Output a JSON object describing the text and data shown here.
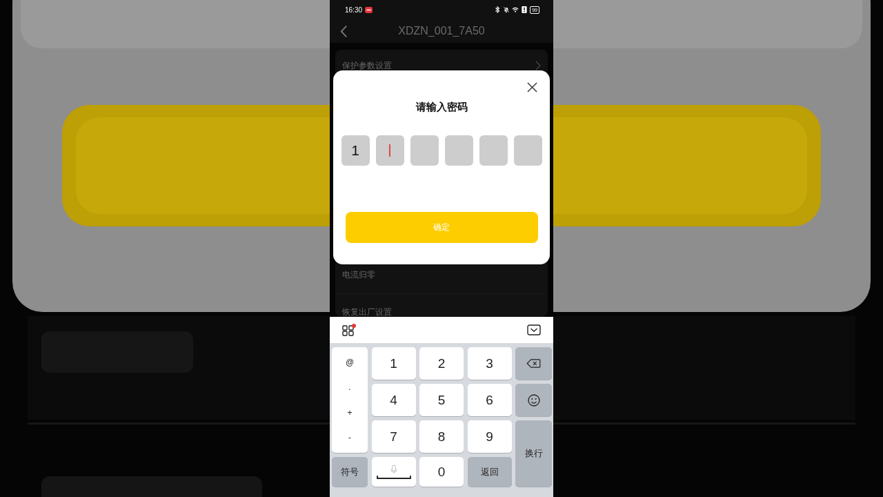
{
  "status_bar": {
    "time": "16:30",
    "battery": "99"
  },
  "header": {
    "title": "XDZN_001_7A50"
  },
  "settings_items": [
    {
      "label": "保护参数设置",
      "chevron": true
    },
    {
      "label": "电流归零",
      "chevron": false
    },
    {
      "label": "恢复出厂设置",
      "chevron": false
    }
  ],
  "dialog": {
    "title": "请输入密码",
    "cells": [
      {
        "value": "1",
        "focused": false
      },
      {
        "focused": true
      },
      {
        "focused": false
      },
      {
        "focused": false
      },
      {
        "focused": false
      },
      {
        "focused": false
      }
    ],
    "confirm": "确定"
  },
  "keyboard": {
    "toolbar": {
      "notification_dot": true
    },
    "symbols": [
      "@",
      ".",
      "+",
      "-"
    ],
    "digits": [
      "1",
      "2",
      "3",
      "4",
      "5",
      "6",
      "7",
      "8",
      "9"
    ],
    "zero": "0",
    "symbol_key": "符号",
    "back_key": "返回",
    "enter_key": "换行"
  }
}
